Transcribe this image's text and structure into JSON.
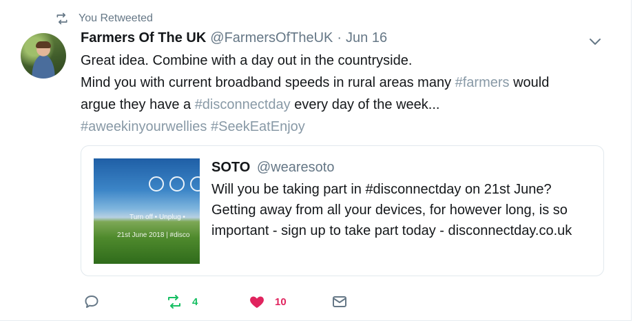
{
  "retweet_context": {
    "label": "You Retweeted",
    "icon": "retweet-icon"
  },
  "tweet": {
    "author_name": "Farmers Of The UK",
    "author_handle": "@FarmersOfTheUK",
    "separator": "·",
    "date": "Jun 16",
    "line1": "Great idea. Combine with a day out in the countryside.",
    "line2_pre": "Mind you with current broadband speeds in rural areas many ",
    "line2_tag": "#farmers",
    "line2_post": " would",
    "line3_pre": "argue they have a ",
    "line3_tag": "#disconnectday",
    "line3_post": " every day of the week...",
    "hashtag1": "#aweekinyourwellies",
    "hashtag2": "#SeekEatEnjoy"
  },
  "quote": {
    "author_name": "SOTO",
    "author_handle": "@wearesoto",
    "text": "Will you be taking part in #disconnectday on 21st June? Getting away from all your devices, for however long, is so important - sign up to take part today - disconnectday.co.uk",
    "image_line1": "Turn off • Unplug •",
    "image_line2": "21st June 2018 | #disco"
  },
  "actions": {
    "reply_icon": "reply-icon",
    "retweet_count": "4",
    "like_count": "10",
    "dm_icon": "envelope-icon"
  },
  "colors": {
    "retweet_active": "#17bf63",
    "like_active": "#e0245e",
    "muted": "#657786",
    "hashtag": "#8899a6",
    "border": "#e1e8ed"
  }
}
